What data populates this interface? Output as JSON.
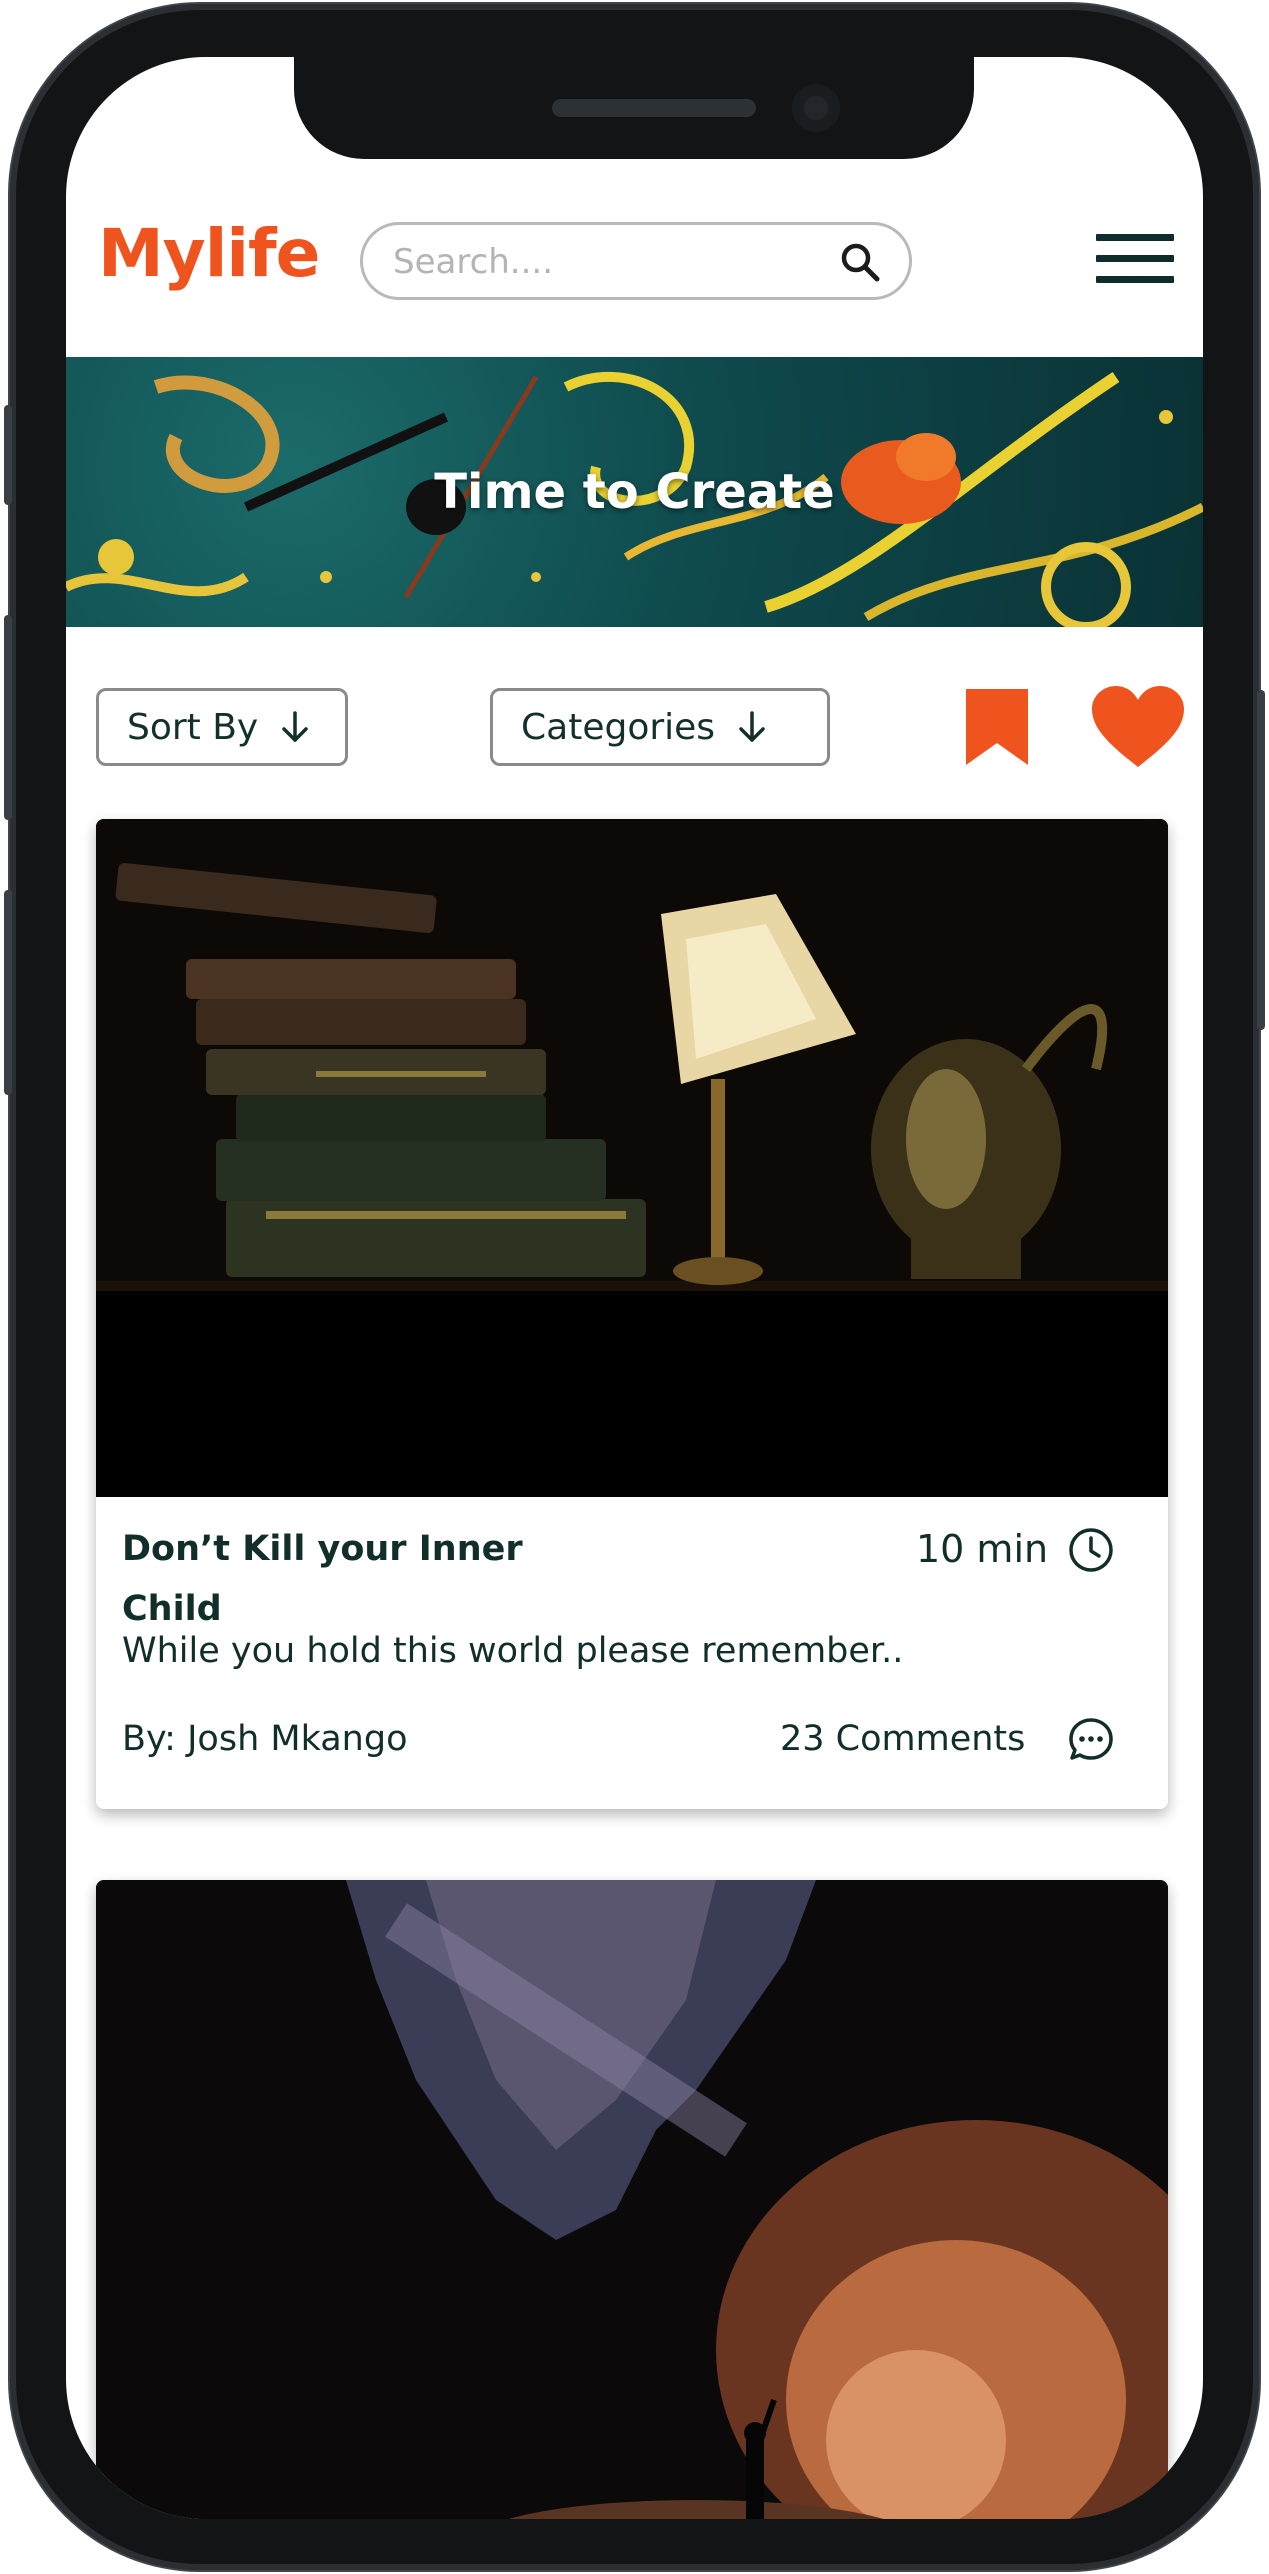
{
  "app": {
    "logo": "Mylife",
    "brand_color": "#f0541e",
    "text_color": "#112e2b"
  },
  "search": {
    "placeholder": "Search....",
    "value": "",
    "icon": "search-icon"
  },
  "header": {
    "menu_icon": "hamburger-menu-icon"
  },
  "banner": {
    "title": "Time to Create"
  },
  "filters": {
    "sort_label": "Sort By",
    "categories_label": "Categories",
    "bookmark_icon": "bookmark-icon",
    "favorites_icon": "heart-icon"
  },
  "posts": [
    {
      "title": "Don’t Kill your Inner Child",
      "read_time": "10 min",
      "excerpt": "While you hold this world please remember..",
      "author": "By: Josh Mkango",
      "comments": "23 Comments",
      "image": "books-and-lamp-still-life"
    },
    {
      "image": "person-in-canyon-under-milky-way"
    }
  ]
}
